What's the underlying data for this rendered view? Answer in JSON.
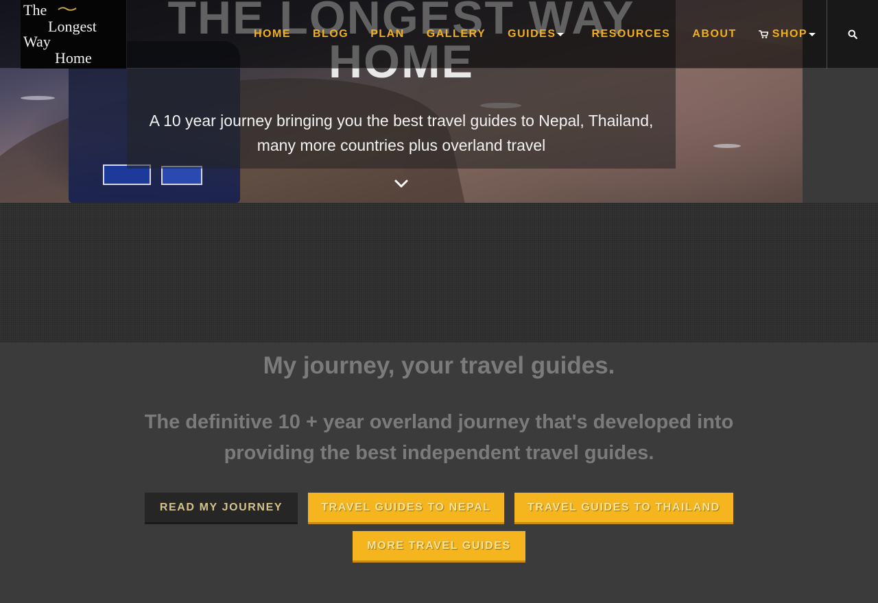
{
  "site": {
    "logo": {
      "line1": "The",
      "line2": "Longest",
      "line3": "Way",
      "line4": "Home"
    }
  },
  "nav": {
    "items": [
      {
        "label": "HOME"
      },
      {
        "label": "BLOG"
      },
      {
        "label": "PLAN"
      },
      {
        "label": "GALLERY"
      },
      {
        "label": "GUIDES"
      },
      {
        "label": "RESOURCES"
      },
      {
        "label": "ABOUT"
      },
      {
        "label": "SHOP"
      }
    ],
    "search_icon": "search-icon"
  },
  "hero": {
    "title": "THE LONGEST WAY HOME",
    "subtitle": "A 10 year journey bringing you the best travel guides to Nepal, Thailand, many more countries plus overland travel",
    "scroll_icon": "chevron-down-icon"
  },
  "main": {
    "tagline": "My journey, your travel guides.",
    "lede": "The definitive 10 + year overland journey that's developed into providing the best independent travel guides.",
    "buttons": {
      "read_journey": "READ MY JOURNEY",
      "nepal": "TRAVEL GUIDES TO NEPAL",
      "thailand": "TRAVEL GUIDES TO THAILAND",
      "more": "MORE TRAVEL GUIDES"
    }
  },
  "colors": {
    "accent": "#f2b01e",
    "button_yellow": "#f4b51f",
    "background": "#3b3b3b",
    "muted_text": "#7b7b7b"
  }
}
